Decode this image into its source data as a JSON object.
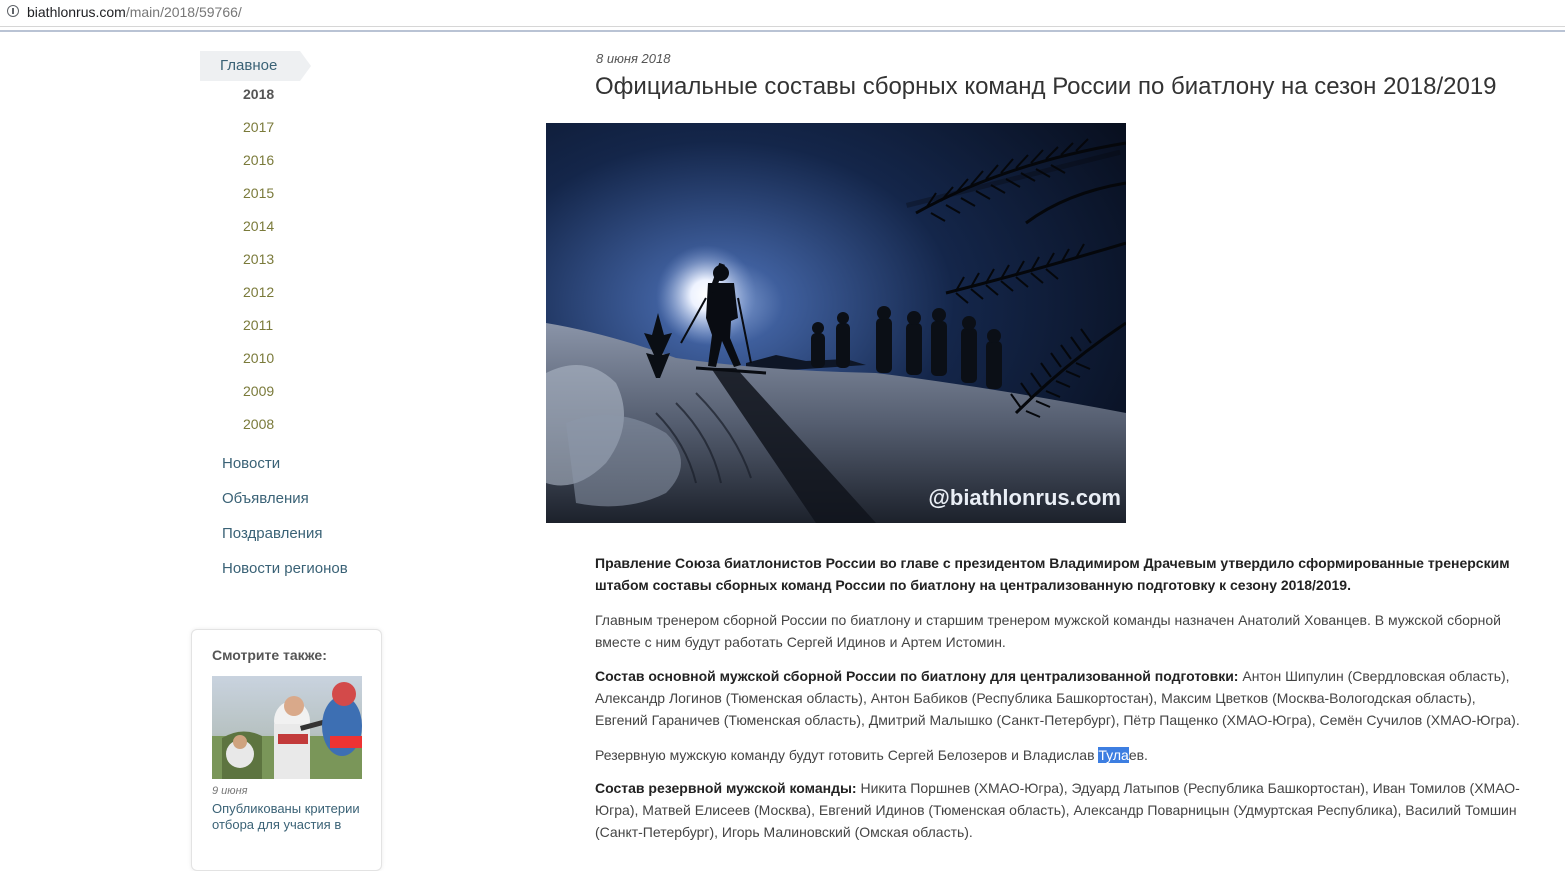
{
  "browser": {
    "url_host": "biathlonrus.com",
    "url_path": "/main/2018/59766/"
  },
  "sidebar": {
    "main_label": "Главное",
    "years": [
      "2018",
      "2017",
      "2016",
      "2015",
      "2014",
      "2013",
      "2012",
      "2011",
      "2010",
      "2009",
      "2008"
    ],
    "active_year": "2018",
    "sections": [
      "Новости",
      "Объявления",
      "Поздравления",
      "Новости регионов"
    ]
  },
  "see_also": {
    "header": "Смотрите также:",
    "date": "9 июня",
    "title": "Опубликованы критерии отбора для участия в"
  },
  "article": {
    "date": "8 июня 2018",
    "title": "Официальные составы сборных команд России по биатлону на сезон 2018/2019",
    "photo_watermark": "@biathlonrus.com",
    "lead": "Правление Союза биатлонистов России во главе с президентом Владимиром Драчевым утвердило сформированные тренерским штабом составы сборных команд России по биатлону на централизованную подготовку к сезону 2018/2019.",
    "p2": "Главным тренером сборной России по биатлону и старшим тренером мужской команды назначен Анатолий Хованцев. В мужской сборной вместе с ним будут работать Сергей Идинов и Артем Истомин.",
    "p3_bold": "Состав основной мужской сборной России по биатлону для централизованной подготовки:",
    "p3_text": " Антон Шипулин (Свердловская область), Александр Логинов (Тюменская область), Антон Бабиков (Республика Башкортостан), Максим Цветков (Москва-Вологодская область), Евгений Гараничев (Тюменская область), Дмитрий Малышко (Санкт-Петербург), Пётр Пащенко (ХМАО-Югра), Семён Сучилов (ХМАО-Югра).",
    "p4_before": "Резервную мужскую команду будут готовить Сергей Белозеров и Владислав ",
    "p4_selected": "Тула",
    "p4_after": "ев.",
    "p5_bold": "Состав резервной мужской команды:",
    "p5_text": " Никита Поршнев (ХМАО-Югра), Эдуард Латыпов (Республика Башкортостан), Иван Томилов (ХМАО-Югра), Матвей Елисеев (Москва), Евгений Идинов (Тюменская область), Александр Поварницын (Удмуртская Республика), Василий Томшин (Санкт-Петербург), Игорь Малиновский (Омская область)."
  }
}
